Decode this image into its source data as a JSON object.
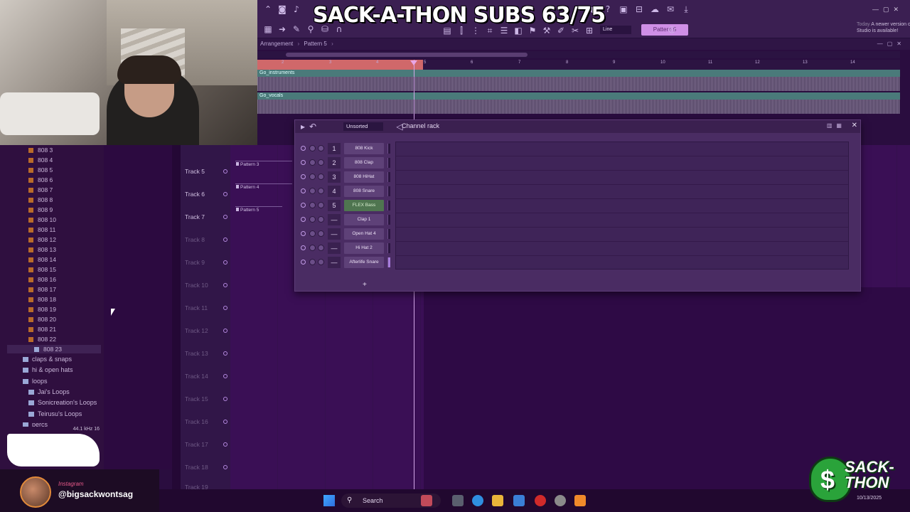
{
  "overlay": {
    "title": "SACK-A-THON SUBS 63/75"
  },
  "toolbar": {
    "line_mode": "Line",
    "pattern": "Pattern 5",
    "news_today": "Today",
    "news_text": "A newer version of FL Studio is available!"
  },
  "breadcrumb": {
    "items": [
      "Arrangement",
      "Pattern 5"
    ]
  },
  "ruler": {
    "ticks": [
      "2",
      "3",
      "4",
      "5",
      "6",
      "7",
      "8",
      "9",
      "10",
      "11",
      "12",
      "13",
      "14"
    ]
  },
  "audio_tracks": [
    {
      "label": "Go_instruments"
    },
    {
      "label": "Go_vocals"
    }
  ],
  "browser": {
    "items": [
      "808 3",
      "808 4",
      "808 5",
      "808 6",
      "808 7",
      "808 8",
      "808 9",
      "808 10",
      "808 11",
      "808 12",
      "808 13",
      "808 14",
      "808 15",
      "808 16",
      "808 17",
      "808 18",
      "808 19",
      "808 20",
      "808 21",
      "808 22",
      "808 23"
    ],
    "folders": [
      "claps & snaps",
      "hi & open hats",
      "loops",
      "Jai's Loops",
      "Sonicreation's Loops",
      "Teirusu's Loops",
      "percs"
    ],
    "sample_rate": "44.1 kHz 16"
  },
  "tracks": [
    {
      "label": "Track 5"
    },
    {
      "label": "Track 6"
    },
    {
      "label": "Track 7"
    },
    {
      "label": "Track 8"
    },
    {
      "label": "Track 9"
    },
    {
      "label": "Track 10"
    },
    {
      "label": "Track 11"
    },
    {
      "label": "Track 12"
    },
    {
      "label": "Track 13"
    },
    {
      "label": "Track 14"
    },
    {
      "label": "Track 15"
    },
    {
      "label": "Track 16"
    },
    {
      "label": "Track 17"
    },
    {
      "label": "Track 18"
    },
    {
      "label": "Track 19"
    }
  ],
  "clips": [
    {
      "label": "Pattern 3"
    },
    {
      "label": "Pattern 4"
    },
    {
      "label": "Pattern 5"
    }
  ],
  "channel_rack": {
    "title": "Channel rack",
    "sort": "Unsorted",
    "add": "+",
    "channels": [
      {
        "num": "1",
        "name": "808 Kick"
      },
      {
        "num": "2",
        "name": "808 Clap"
      },
      {
        "num": "3",
        "name": "808 HiHat"
      },
      {
        "num": "4",
        "name": "808 Snare"
      },
      {
        "num": "5",
        "name": "FLEX Bass"
      },
      {
        "num": "—",
        "name": "Clap 1"
      },
      {
        "num": "—",
        "name": "Open Hat 4"
      },
      {
        "num": "—",
        "name": "Hi Hat 2"
      },
      {
        "num": "—",
        "name": "Afterlife Snare"
      }
    ]
  },
  "social": {
    "platform": "Instagram",
    "handle": "@bigsackwontsag"
  },
  "brand": {
    "line1": "SACK-",
    "line2": "THON"
  },
  "taskbar": {
    "search": "Search",
    "date": "10/13/2025"
  }
}
